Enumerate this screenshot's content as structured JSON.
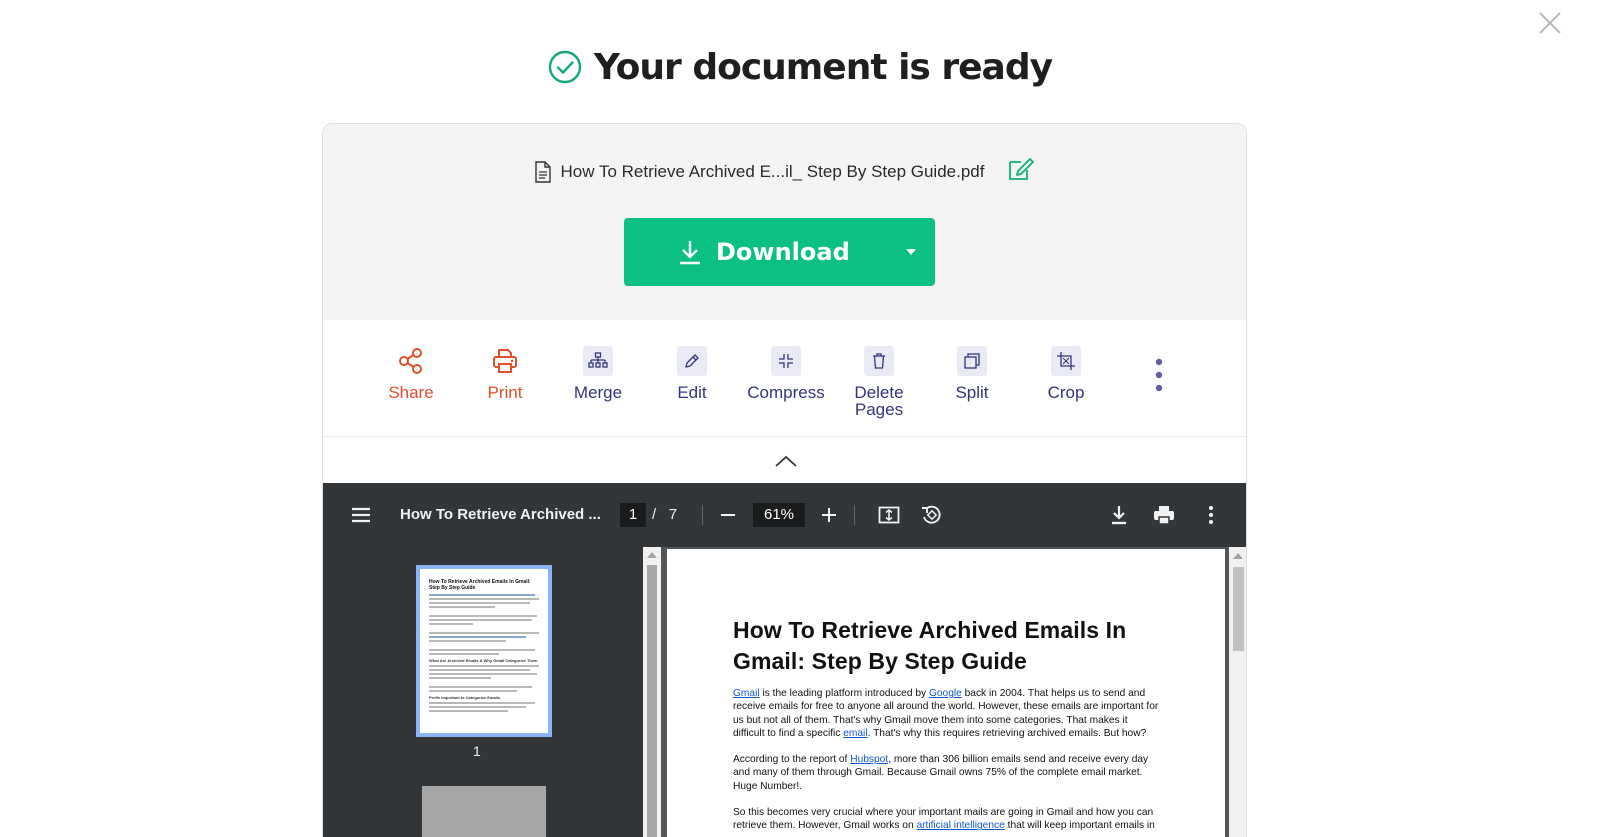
{
  "header": {
    "title": "Your document is ready"
  },
  "file": {
    "name": "How To Retrieve Archived E...il_ Step By Step Guide.pdf"
  },
  "download": {
    "label": "Download"
  },
  "tools": [
    {
      "label": "Share",
      "icon": "share-icon"
    },
    {
      "label": "Print",
      "icon": "printer-icon"
    },
    {
      "label": "Merge",
      "icon": "merge-icon"
    },
    {
      "label": "Edit",
      "icon": "pencil-icon"
    },
    {
      "label": "Compress",
      "icon": "compress-icon"
    },
    {
      "label": "Delete Pages",
      "icon": "trash-icon"
    },
    {
      "label": "Split",
      "icon": "split-icon"
    },
    {
      "label": "Crop",
      "icon": "crop-icon"
    }
  ],
  "viewer": {
    "title": "How To Retrieve Archived ...",
    "current_page": "1",
    "page_separator": "/",
    "total_pages": "7",
    "zoom": "61%",
    "thumbnail_label": "1"
  },
  "thumbnail": {
    "title": "How To Retrieve Archived Emails In Gmail: Step By Step Guide",
    "heading_1": "What Are Archived Emails & Why Gmail Categorize Them",
    "heading_2": "Prefix Important to Categorize Emails"
  },
  "document": {
    "title": "How To Retrieve Archived Emails In Gmail: Step By Step Guide",
    "p1": {
      "link_gmail": "Gmail",
      "t1": " is the leading platform introduced by ",
      "link_google": "Google",
      "t2": " back in 2004. That helps us to send and receive emails for free to anyone all around the world. However, these emails are important for us but not all of them. That's why Gmail move them into some categories. That makes it difficult to find a specific ",
      "link_email": "email",
      "t3": ". That's why this requires retrieving archived emails. But how?"
    },
    "p2": {
      "t1": "According to the report of ",
      "link_hubspot": "Hubspot",
      "t2": ", more than 306 billion emails send and receive every day and many of them through Gmail. Because Gmail owns 75% of the complete email market. Huge Number!."
    },
    "p3": {
      "t1": "So this becomes very crucial where your important mails are going in Gmail and how you can retrieve them. However, Gmail works on ",
      "link_ai": "artificial intelligence",
      "t2": " that will keep important emails in"
    }
  },
  "colors": {
    "accent_green": "#0bbf85",
    "tool_orange": "#e0502c",
    "tool_navy": "#33357a",
    "viewer_toolbar": "#323639"
  }
}
